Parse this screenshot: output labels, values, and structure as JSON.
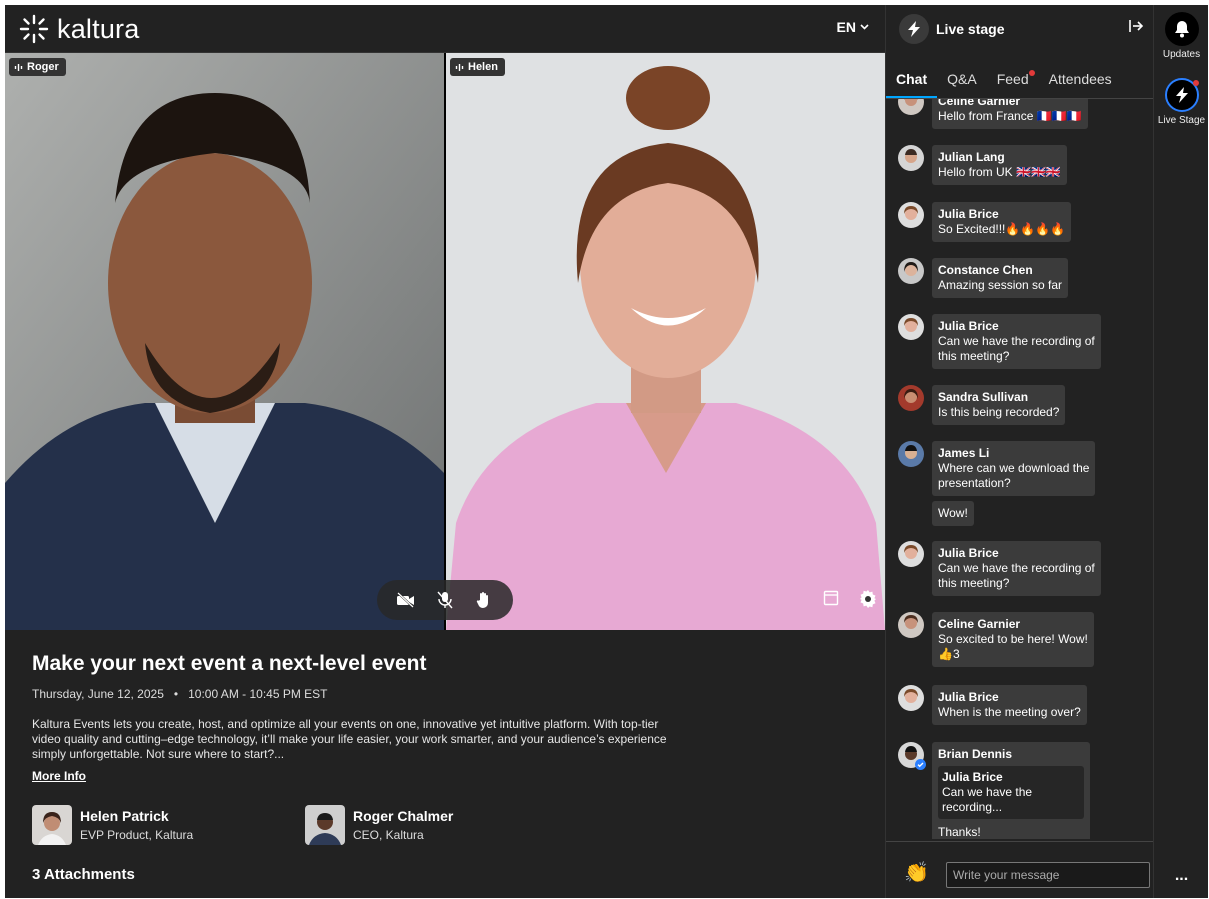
{
  "header": {
    "brand": "kaltura",
    "language": "EN"
  },
  "video": {
    "tiles": [
      {
        "name": "Roger"
      },
      {
        "name": "Helen"
      }
    ]
  },
  "event": {
    "title": "Make your next event a next-level event",
    "date": "Thursday, June 12, 2025",
    "time": "10:00 AM - 10:45 PM EST",
    "description": "Kaltura Events lets you create, host, and optimize all your events on one, innovative yet intuitive platform. With top-tier video quality and cutting–edge technology, it’ll make your life easier, your work smarter, and your audience’s experience simply unforgettable. Not sure where to start?...",
    "more_info": "More Info",
    "speakers": [
      {
        "name": "Helen Patrick",
        "role": "EVP Product, Kaltura"
      },
      {
        "name": "Roger Chalmer",
        "role": "CEO, Kaltura"
      }
    ],
    "attachments": "3 Attachments"
  },
  "panel": {
    "title": "Live stage",
    "tabs": [
      "Chat",
      "Q&A",
      "Feed",
      "Attendees"
    ],
    "active_tab": "Chat",
    "composer_placeholder": "Write your message",
    "messages": [
      {
        "author": "Celine Garnier",
        "lines": [
          "Hello from France 🇫🇷🇫🇷🇫🇷"
        ]
      },
      {
        "author": "Julian Lang",
        "lines": [
          "Hello from UK 🇬🇧🇬🇧🇬🇧"
        ]
      },
      {
        "author": "Julia Brice",
        "lines": [
          "So Excited!!!🔥🔥🔥🔥"
        ]
      },
      {
        "author": "Constance Chen",
        "lines": [
          "Amazing session so far"
        ]
      },
      {
        "author": "Julia Brice",
        "lines": [
          "Can we have the recording of",
          "this meeting?"
        ]
      },
      {
        "author": "Sandra Sullivan",
        "lines": [
          "Is this being recorded?"
        ]
      },
      {
        "author": "James Li",
        "lines": [
          "Where can we download the",
          "presentation?"
        ]
      },
      {
        "author": "",
        "lines": [
          "Wow!"
        ]
      },
      {
        "author": "Julia Brice",
        "lines": [
          "Can we have the recording of",
          "this meeting?"
        ]
      },
      {
        "author": "Celine Garnier",
        "lines": [
          "So excited to be here! Wow!"
        ],
        "reaction": "3"
      },
      {
        "author": "Julia Brice",
        "lines": [
          "When is the meeting over?"
        ]
      },
      {
        "author": "Brian Dennis",
        "quote_author": "Julia Brice",
        "quote_text": "Can we have the recording...",
        "lines": [
          "Thanks!"
        ]
      }
    ]
  },
  "rail": {
    "updates": "Updates",
    "live_stage": "Live Stage",
    "more": "..."
  },
  "colors": {
    "background": "#222222",
    "bubble": "#3b3b3b",
    "accent": "#00a6ff",
    "notification": "#e23a3a"
  }
}
